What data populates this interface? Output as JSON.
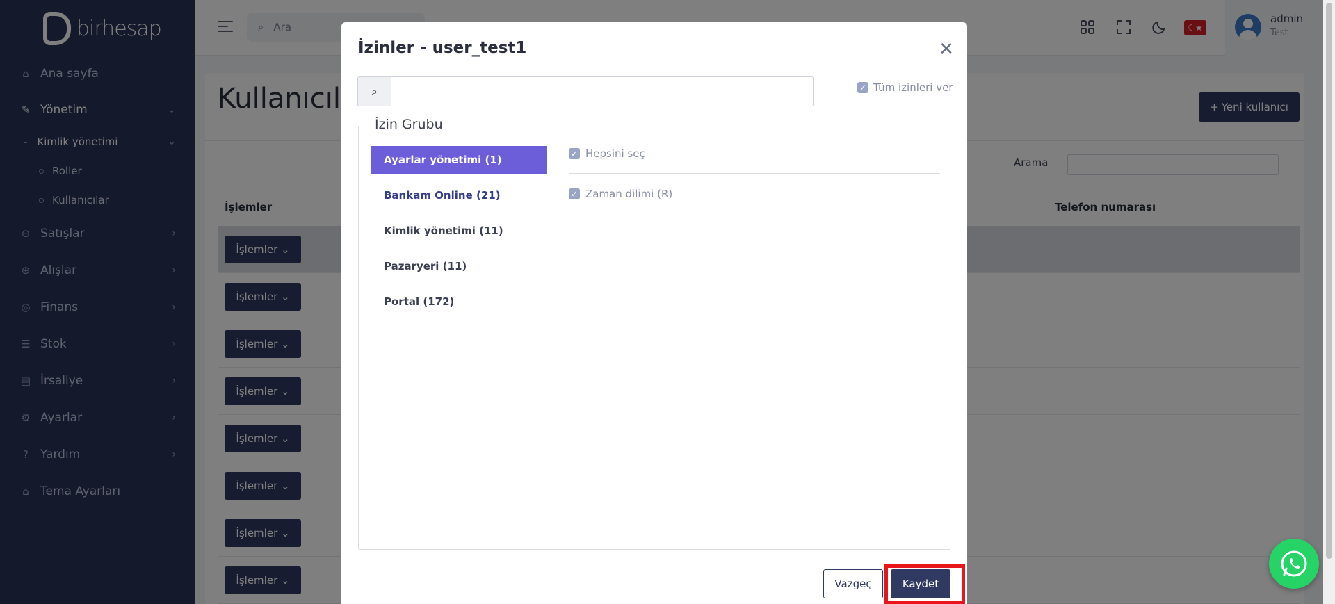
{
  "brand": {
    "logo_text": "birhesap"
  },
  "sidebar": {
    "items": [
      {
        "label": "Ana sayfa",
        "icon": "home-icon"
      },
      {
        "label": "Yönetim",
        "icon": "wrench-icon"
      },
      {
        "label": "Kimlik yönetimi"
      },
      {
        "label": "Roller"
      },
      {
        "label": "Kullanıcılar"
      },
      {
        "label": "Satışlar",
        "icon": "sales-icon"
      },
      {
        "label": "Alışlar",
        "icon": "purchases-icon"
      },
      {
        "label": "Finans",
        "icon": "finance-icon"
      },
      {
        "label": "Stok",
        "icon": "stock-icon"
      },
      {
        "label": "İrsaliye",
        "icon": "waybill-icon"
      },
      {
        "label": "Ayarlar",
        "icon": "settings-icon"
      },
      {
        "label": "Yardım",
        "icon": "help-icon"
      },
      {
        "label": "Tema Ayarları",
        "icon": "theme-icon"
      }
    ]
  },
  "header": {
    "search_placeholder": "Ara",
    "user_name": "admin",
    "user_role": "Test"
  },
  "page": {
    "title": "Kullanıcıla",
    "new_user_label": "Yeni kullanıcı",
    "search_label": "Arama",
    "columns": [
      "İşlemler",
      "Telefon numarası"
    ],
    "row_action_label": "İşlemler"
  },
  "modal": {
    "title": "İzinler - user_test1",
    "grant_all_label": "Tüm izinleri ver",
    "group_legend": "İzin Grubu",
    "groups": [
      "Ayarlar yönetimi (1)",
      "Bankam Online (21)",
      "Kimlik yönetimi (11)",
      "Pazaryeri (11)",
      "Portal (172)"
    ],
    "select_all_label": "Hepsini seç",
    "permissions": [
      "Zaman dilimi (R)"
    ],
    "cancel_label": "Vazgeç",
    "save_label": "Kaydet"
  },
  "colors": {
    "sidebar_bg": "#2b3359",
    "primary": "#2f3962",
    "active_group": "#6c5ed8",
    "highlight": "#e8151a",
    "whatsapp": "#25d366"
  }
}
